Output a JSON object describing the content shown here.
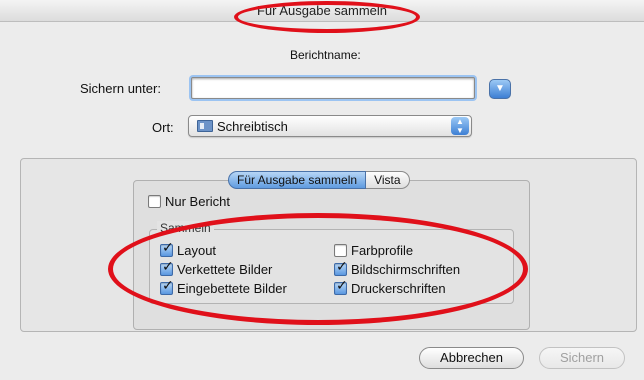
{
  "window": {
    "title": "Für Ausgabe sammeln"
  },
  "form": {
    "report_name_label": "Berichtname:",
    "save_as_label": "Sichern unter:",
    "save_as_value": "",
    "location_label": "Ort:",
    "location_value": "Schreibtisch"
  },
  "tabs": [
    {
      "label": "Für Ausgabe sammeln",
      "selected": true
    },
    {
      "label": "Vista",
      "selected": false
    }
  ],
  "options": {
    "report_only": {
      "label": "Nur Bericht",
      "checked": false
    },
    "group_title": "Sammeln",
    "left": [
      {
        "label": "Layout",
        "checked": true
      },
      {
        "label": "Verkettete Bilder",
        "checked": true
      },
      {
        "label": "Eingebettete Bilder",
        "checked": true
      }
    ],
    "right": [
      {
        "label": "Farbprofile",
        "checked": false
      },
      {
        "label": "Bildschirmschriften",
        "checked": true
      },
      {
        "label": "Druckerschriften",
        "checked": true
      }
    ]
  },
  "buttons": {
    "cancel": "Abbrechen",
    "save": "Sichern"
  },
  "icons": {
    "expand": "triangle-down-icon",
    "location": "folder-icon",
    "popup": "up-down-arrows-icon"
  },
  "colors": {
    "annotation": "#e0101a",
    "accent": "#3d7fd4"
  }
}
